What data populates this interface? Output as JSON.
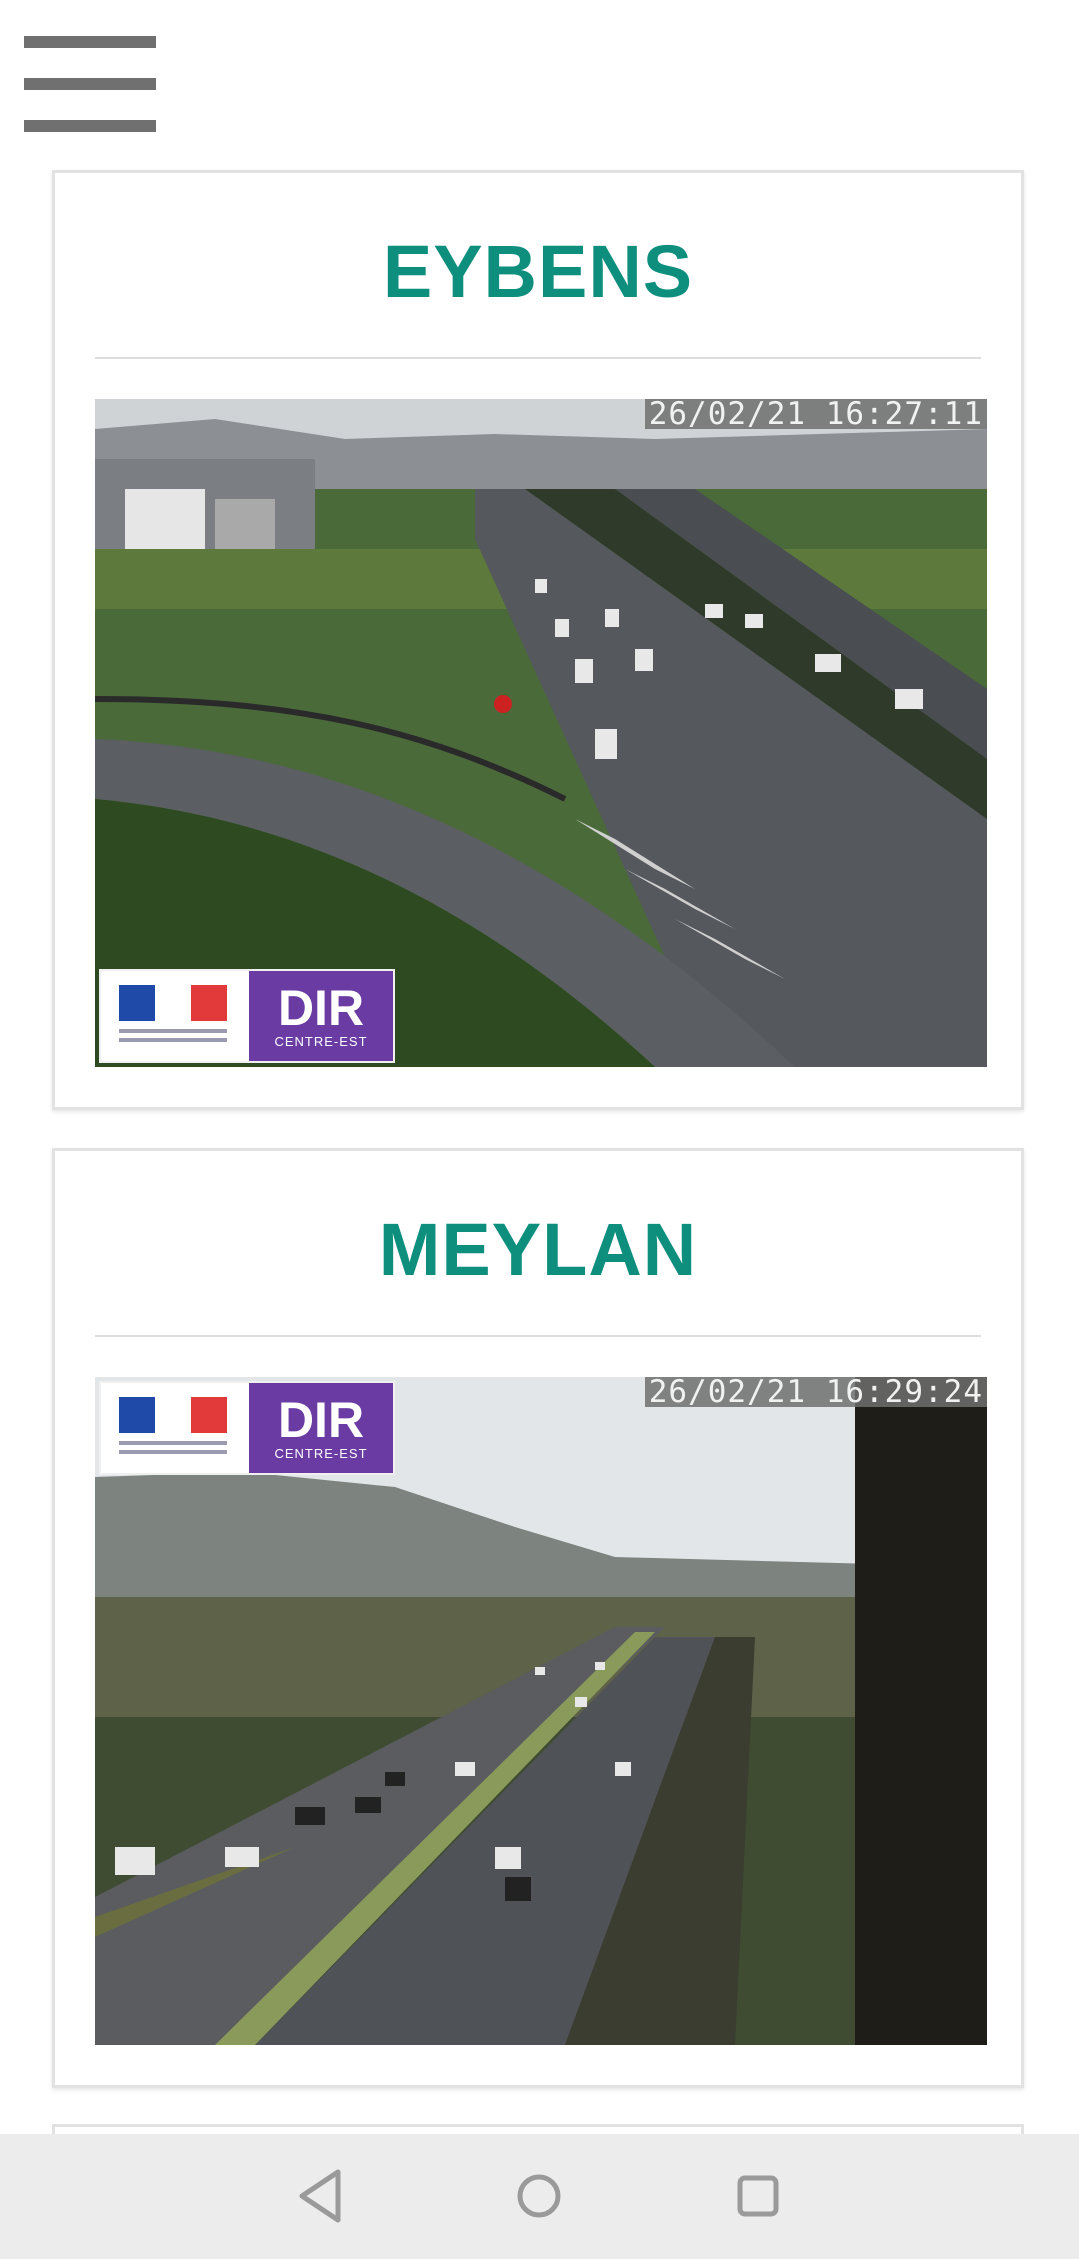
{
  "header": {
    "menu_icon": "hamburger-menu-icon"
  },
  "cameras": [
    {
      "title": "EYBENS",
      "timestamp": "26/02/21 16:27:11",
      "logo": {
        "name": "DIR",
        "subtitle": "CENTRE-EST",
        "flag_colors": [
          "#1f4aa8",
          "#ffffff",
          "#e23a3a"
        ]
      }
    },
    {
      "title": "MEYLAN",
      "timestamp": "26/02/21 16:29:24",
      "logo": {
        "name": "DIR",
        "subtitle": "CENTRE-EST",
        "flag_colors": [
          "#1f4aa8",
          "#ffffff",
          "#e23a3a"
        ]
      }
    }
  ],
  "navbar": {
    "back_icon": "back-triangle-icon",
    "home_icon": "home-circle-icon",
    "recent_icon": "recent-apps-square-icon"
  },
  "colors": {
    "title": "#0e8f7e",
    "logo_purple": "#6a3ca3",
    "navbar_bg": "#ececec"
  }
}
